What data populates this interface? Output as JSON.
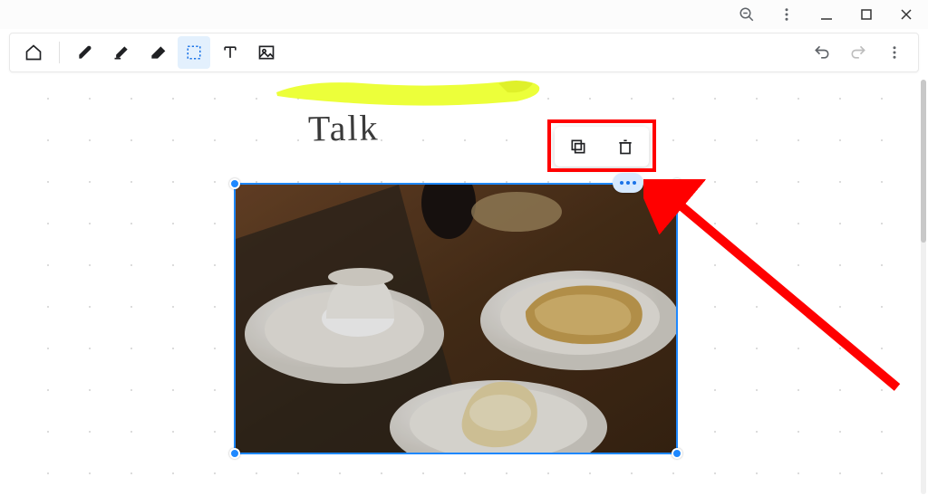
{
  "titlebar": {
    "icons": [
      "zoom-out",
      "kebab",
      "minimize",
      "maximize",
      "close"
    ]
  },
  "toolbar": {
    "home": "home",
    "tools": [
      "pen",
      "highlighter",
      "eraser",
      "select",
      "text",
      "image"
    ],
    "active_tool": "select",
    "right": [
      "undo",
      "redo",
      "more"
    ]
  },
  "canvas": {
    "handwritten_text": "Talk",
    "highlighter_color": "#f1ff3c",
    "selection": {
      "type": "image",
      "description": "photo of a table with plates of food (toast, dessert, coffee cup)",
      "border_color": "#1e88ff",
      "handles": 4,
      "more_menu_open": true
    },
    "context_menu": {
      "items": [
        "copy",
        "delete"
      ]
    }
  },
  "annotation": {
    "highlight_target": "more-options-pill",
    "arrow_color": "#ff0000"
  }
}
